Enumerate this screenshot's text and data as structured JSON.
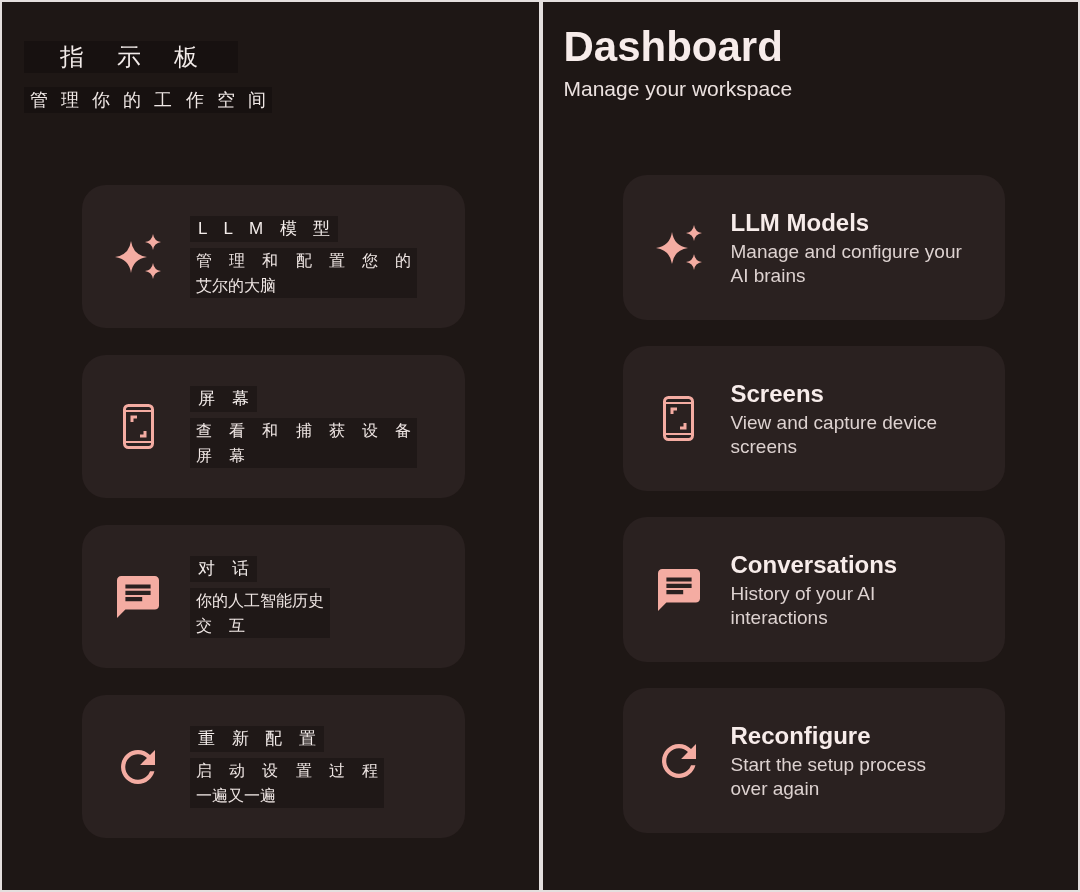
{
  "panels": [
    {
      "kind": "translated",
      "title": "指 示 板",
      "subtitle": "管 理 你 的 工 作 空 间",
      "cards": [
        {
          "kind": "sparkles",
          "title": "L L M 模 型",
          "description": [
            "管 理 和 配 置 您 的",
            "艾尔的大脑"
          ]
        },
        {
          "kind": "screenshot",
          "title": "屏 幕",
          "description": [
            "查 看 和 捕 获 设 备",
            "屏 幕"
          ]
        },
        {
          "kind": "chat",
          "title": "对 话",
          "description": [
            "你的人工智能历史",
            "交 互"
          ]
        },
        {
          "kind": "refresh",
          "title": "重 新 配 置",
          "description": [
            "启 动 设 置 过 程",
            "一遍又一遍"
          ]
        }
      ]
    },
    {
      "kind": "original",
      "title": "Dashboard",
      "subtitle": "Manage your workspace",
      "cards": [
        {
          "kind": "sparkles",
          "title": "LLM Models",
          "description": [
            "Manage and configure your",
            "AI brains"
          ]
        },
        {
          "kind": "screenshot",
          "title": "Screens",
          "description": [
            "View and capture device",
            "screens"
          ]
        },
        {
          "kind": "chat",
          "title": "Conversations",
          "description": [
            "History of your AI",
            "interactions"
          ]
        },
        {
          "kind": "refresh",
          "title": "Reconfigure",
          "description": [
            "Start the setup process",
            "over again"
          ]
        }
      ]
    }
  ]
}
